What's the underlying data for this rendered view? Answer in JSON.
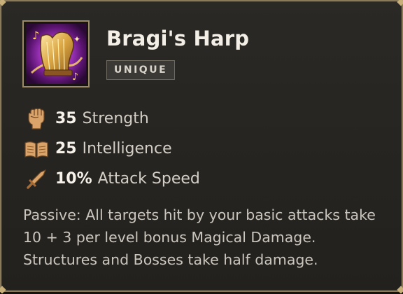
{
  "item": {
    "name": "Bragi's Harp",
    "rarity": "UNIQUE",
    "icon": "golden-harp-icon"
  },
  "stats": [
    {
      "value": "35",
      "label": "Strength",
      "icon": "fist-icon"
    },
    {
      "value": "25",
      "label": "Intelligence",
      "icon": "book-icon"
    },
    {
      "value": "10%",
      "label": "Attack Speed",
      "icon": "sword-icon"
    }
  ],
  "description": {
    "line1": "Passive: All targets hit by your basic attacks take",
    "line2": "10 + 3 per level bonus Magical Damage.",
    "line3": "Structures and Bosses take half damage."
  },
  "colors": {
    "frame": "#8a7a5a",
    "stat_icon": "#d9a36a",
    "icon_glow": "#b03ccf"
  }
}
